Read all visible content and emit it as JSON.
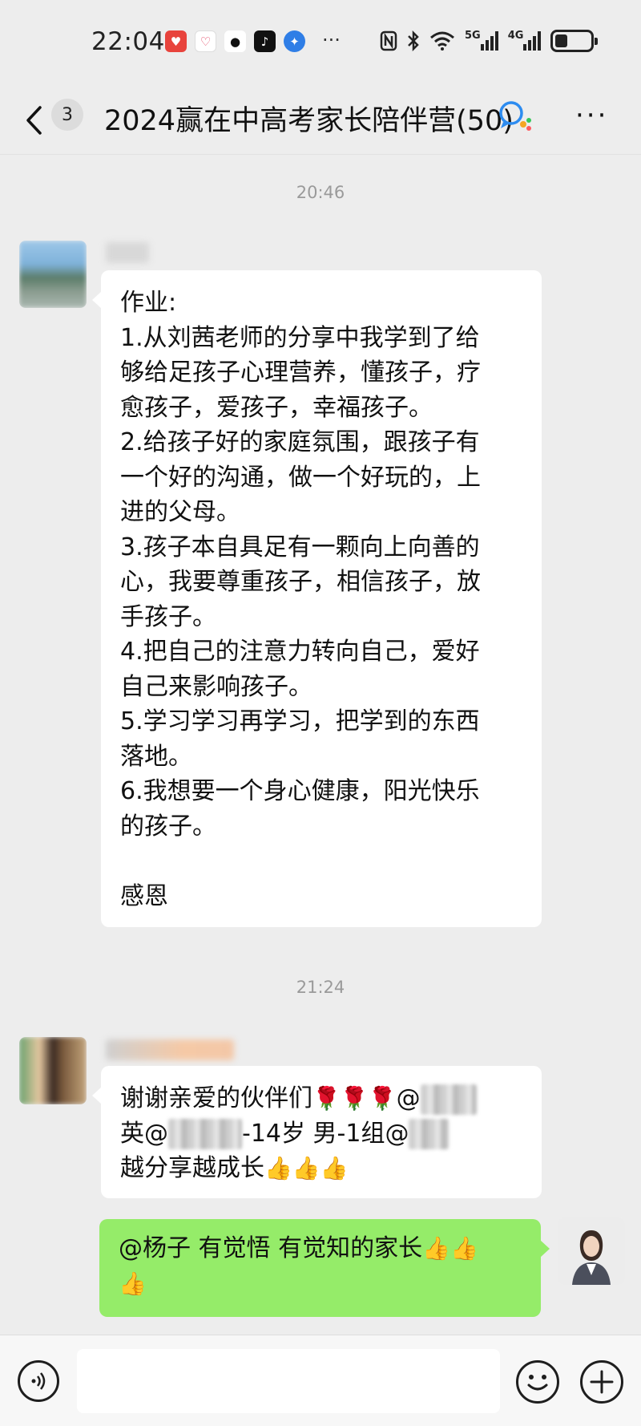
{
  "status_bar": {
    "time": "22:04",
    "more": "···",
    "network_5g": "5G",
    "network_4g": "4G"
  },
  "header": {
    "unread_count": "3",
    "title": "2024赢在中高考家长陪伴营(50)"
  },
  "messages": [
    {
      "timestamp": "20:46",
      "lines": [
        "作业:",
        "1.从刘茜老师的分享中我学到了给",
        "够给足孩子心理营养，懂孩子，疗",
        "愈孩子，爱孩子，幸福孩子。",
        "2.给孩子好的家庭氛围，跟孩子有",
        "一个好的沟通，做一个好玩的，上",
        "进的父母。",
        "3.孩子本自具足有一颗向上向善的",
        "心，我要尊重孩子，相信孩子，放",
        "手孩子。",
        "4.把自己的注意力转向自己，爱好",
        "自己来影响孩子。",
        "5.学习学习再学习，把学到的东西",
        "落地。",
        "6.我想要一个身心健康，阳光快乐",
        "的孩子。",
        "",
        "感恩"
      ]
    },
    {
      "timestamp": "21:24",
      "line1_text": "谢谢亲爱的伙伴们",
      "line1_mention": "@",
      "line2_start": "英@",
      "line2_mid": "-14岁 男-1组@",
      "line3_text": "越分享越成长"
    },
    {
      "text": "@杨子  有觉悟 有觉知的家长"
    }
  ],
  "icons": {
    "back": "chevron-left-icon",
    "group": "group-chat-icon",
    "menu": "more-icon",
    "voice": "voice-icon",
    "emoji": "emoji-icon",
    "add": "plus-icon",
    "rose": "🌹",
    "thumb": "👍"
  },
  "colors": {
    "background": "#ededed",
    "bubble_self": "#95ec69",
    "bubble_other": "#ffffff"
  }
}
